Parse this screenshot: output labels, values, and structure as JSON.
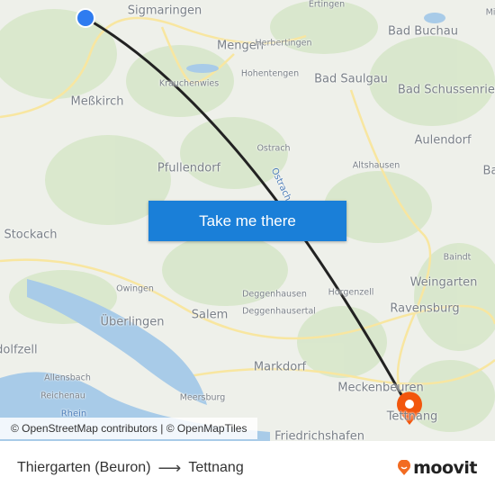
{
  "map": {
    "places": [
      {
        "name": "Sigmaringen",
        "size": "big"
      },
      {
        "name": "Ertingen",
        "size": "sm"
      },
      {
        "name": "Bad Buchau",
        "size": "big"
      },
      {
        "name": "Mengen",
        "size": "big"
      },
      {
        "name": "Herbertingen",
        "size": "sm"
      },
      {
        "name": "Hohentengen",
        "size": "sm"
      },
      {
        "name": "Krauchenwies",
        "size": "sm"
      },
      {
        "name": "Bad Saulgau",
        "size": "big"
      },
      {
        "name": "Bad Schussenried",
        "size": "big"
      },
      {
        "name": "Meßkirch",
        "size": "big"
      },
      {
        "name": "Ostrach",
        "size": "sm"
      },
      {
        "name": "Aulendorf",
        "size": "big"
      },
      {
        "name": "Pfullendorf",
        "size": "big"
      },
      {
        "name": "Altshausen",
        "size": "sm"
      },
      {
        "name": "Stockach",
        "size": "big"
      },
      {
        "name": "Baindt",
        "size": "sm"
      },
      {
        "name": "Owingen",
        "size": "sm"
      },
      {
        "name": "Deggenhausen",
        "size": "sm"
      },
      {
        "name": "Horgenzell",
        "size": "sm"
      },
      {
        "name": "Weingarten",
        "size": "big"
      },
      {
        "name": "Überlingen",
        "size": "big"
      },
      {
        "name": "Salem",
        "size": "big"
      },
      {
        "name": "Deggenhausertal",
        "size": "sm"
      },
      {
        "name": "Ravensburg",
        "size": "big"
      },
      {
        "name": "Radolfzell",
        "size": "big"
      },
      {
        "name": "Allensbach",
        "size": "sm"
      },
      {
        "name": "Markdorf",
        "size": "big"
      },
      {
        "name": "Meckenbeuren",
        "size": "big"
      },
      {
        "name": "Reichenau",
        "size": "sm"
      },
      {
        "name": "Meersburg",
        "size": "sm"
      },
      {
        "name": "Tettnang",
        "size": "big"
      },
      {
        "name": "Friedrichshafen",
        "size": "big"
      },
      {
        "name": "Ba",
        "size": "big"
      },
      {
        "name": "Mi",
        "size": "sm"
      }
    ],
    "rivers": [
      {
        "name": "Ostrach"
      },
      {
        "name": "Rhein"
      }
    ],
    "origin_color": "#2f7cf0",
    "destination_color": "#f2560d",
    "route_color": "#222222"
  },
  "cta": {
    "label": "Take me there"
  },
  "attribution": "© OpenStreetMap contributors | © OpenMapTiles",
  "footer": {
    "origin": "Thiergarten (Beuron)",
    "arrow": "⟶",
    "destination": "Tettnang",
    "logo": "moovit",
    "brand_color": "#f26b21"
  }
}
